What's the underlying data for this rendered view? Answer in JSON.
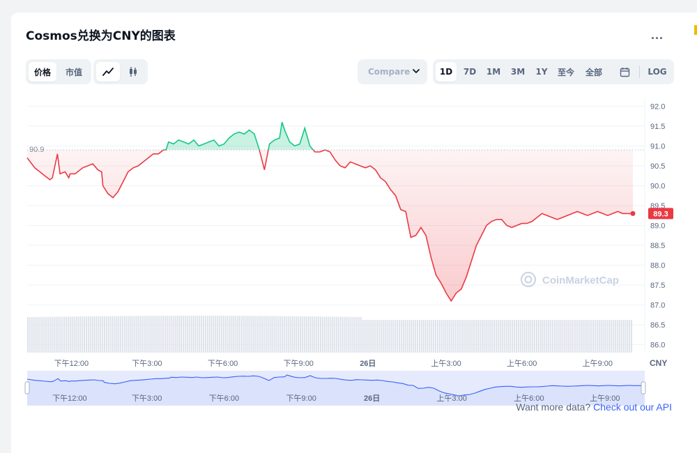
{
  "header": {
    "title": "Cosmos兑换为CNY的图表",
    "more_label": "..."
  },
  "controls": {
    "type_tabs": [
      {
        "label": "价格",
        "active": true
      },
      {
        "label": "市值",
        "active": false
      }
    ],
    "view_icons": [
      {
        "name": "line-chart-icon",
        "active": true
      },
      {
        "name": "candlestick-icon",
        "active": false
      }
    ],
    "compare_label": "Compare",
    "ranges": [
      {
        "label": "1D",
        "active": true
      },
      {
        "label": "7D"
      },
      {
        "label": "1M"
      },
      {
        "label": "3M"
      },
      {
        "label": "1Y"
      },
      {
        "label": "至今"
      },
      {
        "label": "全部"
      }
    ],
    "calendar_icon": "calendar-icon",
    "log_label": "LOG"
  },
  "chart_data": {
    "type": "line",
    "open_price": 90.9,
    "open_label": "90.9",
    "current_price": 89.3,
    "current_label": "89.3",
    "ylim": [
      85.8,
      92.2
    ],
    "yticks": [
      "92.0",
      "91.5",
      "91.0",
      "90.5",
      "90.0",
      "89.5",
      "89.0",
      "88.5",
      "88.0",
      "87.5",
      "87.0",
      "86.5",
      "86.0"
    ],
    "xticks": [
      "下午12:00",
      "下午3:00",
      "下午6:00",
      "下午9:00",
      "26日",
      "上午3:00",
      "上午6:00",
      "上午9:00"
    ],
    "currency": "CNY",
    "watermark": "CoinMarketCap",
    "up_color": "#16c784",
    "down_color": "#ea3943",
    "x_hours": [
      0,
      0.3,
      0.5,
      0.7,
      0.9,
      1.0,
      1.2,
      1.3,
      1.5,
      1.65,
      1.7,
      1.9,
      2.0,
      2.2,
      2.4,
      2.6,
      2.8,
      2.95,
      3.0,
      3.2,
      3.4,
      3.6,
      3.8,
      4.0,
      4.2,
      4.4,
      4.6,
      4.8,
      5.0,
      5.2,
      5.4,
      5.5,
      5.6,
      5.8,
      6.0,
      6.2,
      6.4,
      6.6,
      6.8,
      7.0,
      7.2,
      7.4,
      7.6,
      7.8,
      8.0,
      8.2,
      8.4,
      8.6,
      8.8,
      9.0,
      9.2,
      9.4,
      9.6,
      9.8,
      10.0,
      10.1,
      10.2,
      10.4,
      10.6,
      10.8,
      11.0,
      11.2,
      11.4,
      11.6,
      11.8,
      12.0,
      12.2,
      12.4,
      12.6,
      12.8,
      13.0,
      13.2,
      13.4,
      13.6,
      13.8,
      14.0,
      14.2,
      14.4,
      14.6,
      14.8,
      15.0,
      15.2,
      15.4,
      15.6,
      15.8,
      16.0,
      16.2,
      16.4,
      16.6,
      16.8,
      17.0,
      17.2,
      17.4,
      17.6,
      17.8,
      18.0,
      18.2,
      18.4,
      18.6,
      18.8,
      19.0,
      19.2,
      19.4,
      19.6,
      19.8,
      20.0,
      20.2,
      20.4,
      20.6,
      20.8,
      21.0,
      21.2,
      21.4,
      21.6,
      21.8,
      22.0,
      22.2,
      22.4,
      22.6,
      22.8,
      23.0,
      23.2,
      23.4,
      23.6,
      23.8,
      24.0
    ],
    "prices": [
      90.7,
      90.45,
      90.35,
      90.25,
      90.15,
      90.2,
      90.8,
      90.3,
      90.35,
      90.2,
      90.3,
      90.3,
      90.35,
      90.45,
      90.5,
      90.55,
      90.4,
      90.35,
      90.0,
      89.8,
      89.7,
      89.85,
      90.1,
      90.35,
      90.45,
      90.5,
      90.6,
      90.7,
      90.8,
      90.8,
      90.9,
      90.9,
      91.1,
      91.05,
      91.15,
      91.1,
      91.05,
      91.15,
      91.0,
      91.05,
      91.1,
      91.15,
      91.0,
      91.05,
      91.2,
      91.3,
      91.35,
      91.3,
      91.4,
      91.3,
      90.9,
      90.4,
      91.05,
      91.15,
      91.2,
      91.6,
      91.4,
      91.1,
      91.0,
      91.05,
      91.45,
      91.0,
      90.85,
      90.85,
      90.9,
      90.85,
      90.65,
      90.5,
      90.45,
      90.6,
      90.55,
      90.5,
      90.45,
      90.5,
      90.4,
      90.2,
      90.1,
      89.9,
      89.75,
      89.4,
      89.35,
      88.7,
      88.75,
      88.95,
      88.75,
      88.2,
      87.75,
      87.55,
      87.3,
      87.1,
      87.3,
      87.4,
      87.7,
      88.1,
      88.5,
      88.75,
      89.0,
      89.1,
      89.15,
      89.15,
      89.0,
      88.95,
      89.0,
      89.05,
      89.05,
      89.1,
      89.2,
      89.3,
      89.25,
      89.2,
      89.15,
      89.2,
      89.25,
      89.3,
      89.35,
      89.3,
      89.25,
      89.3,
      89.35,
      89.3,
      89.25,
      89.3,
      89.35,
      89.3,
      89.3,
      89.3
    ],
    "nav_xticks": [
      "下午12:00",
      "下午3:00",
      "下午6:00",
      "下午9:00",
      "26日",
      "上午3:00",
      "上午6:00",
      "上午9:00"
    ]
  },
  "footer": {
    "text": "Want more data?",
    "link": "Check out our API"
  }
}
